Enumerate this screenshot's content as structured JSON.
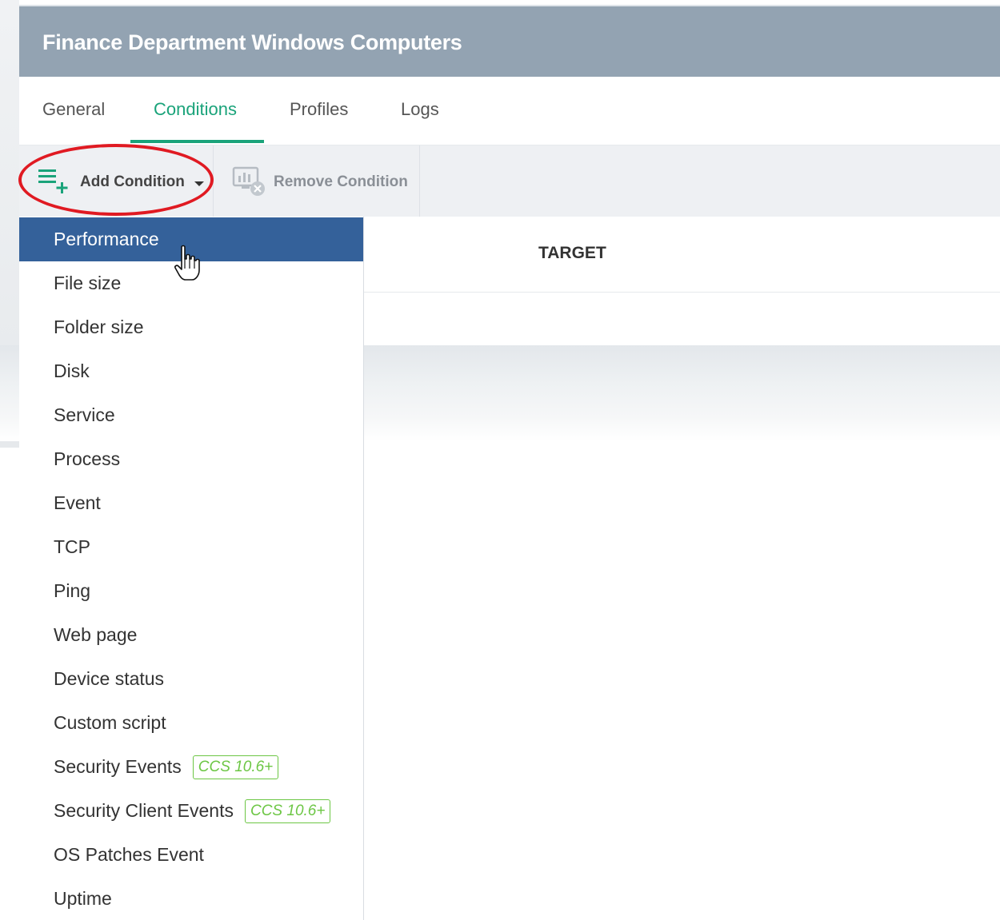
{
  "header": {
    "title": "Finance Department Windows Computers"
  },
  "tabs": [
    {
      "label": "General"
    },
    {
      "label": "Conditions"
    },
    {
      "label": "Profiles"
    },
    {
      "label": "Logs"
    }
  ],
  "active_tab": "Conditions",
  "toolbar": {
    "add_condition_label": "Add Condition",
    "remove_condition_label": "Remove Condition"
  },
  "table": {
    "column_target": "TARGET"
  },
  "dropdown": {
    "items": [
      {
        "label": "Performance"
      },
      {
        "label": "File size"
      },
      {
        "label": "Folder size"
      },
      {
        "label": "Disk"
      },
      {
        "label": "Service"
      },
      {
        "label": "Process"
      },
      {
        "label": "Event"
      },
      {
        "label": "TCP"
      },
      {
        "label": "Ping"
      },
      {
        "label": "Web page"
      },
      {
        "label": "Device status"
      },
      {
        "label": "Custom script"
      },
      {
        "label": "Security Events",
        "badge": "CCS 10.6+"
      },
      {
        "label": "Security Client Events",
        "badge": "CCS 10.6+"
      },
      {
        "label": "OS Patches Event"
      },
      {
        "label": "Uptime"
      }
    ],
    "highlighted": "Performance"
  },
  "colors": {
    "header_bg": "#93a3b2",
    "accent_green": "#1aa37a",
    "menu_highlight": "#34619a",
    "badge_green": "#6cc644",
    "annotation_red": "#e01a22"
  },
  "icons": {
    "add_condition": "list-plus-icon",
    "remove_condition": "monitor-remove-icon",
    "cursor": "hand-pointer-icon"
  }
}
